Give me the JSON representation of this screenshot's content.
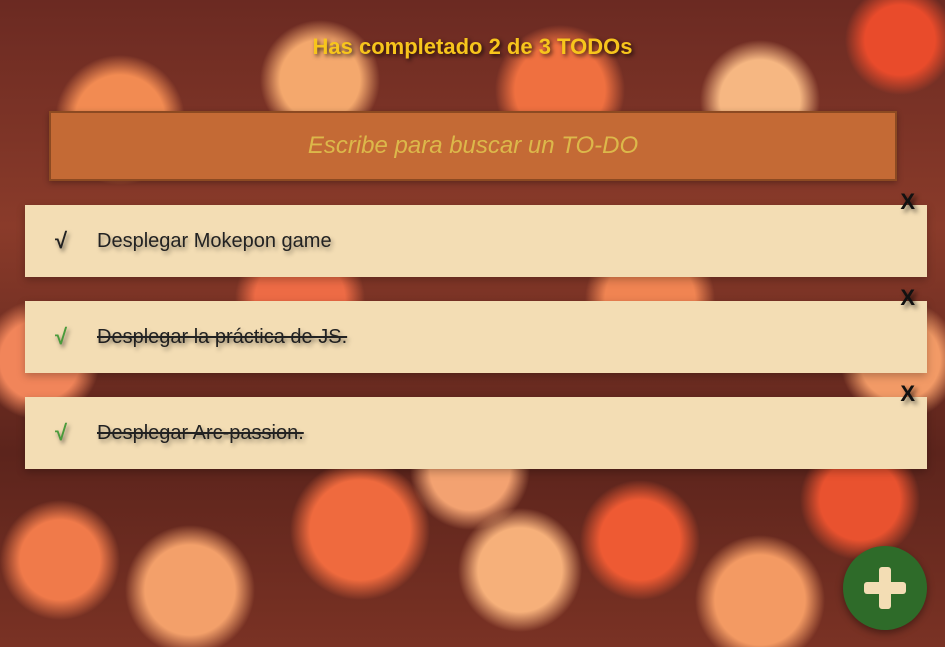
{
  "counter": {
    "text": "Has completado 2 de 3 TODOs"
  },
  "search": {
    "placeholder": "Escribe para buscar un TO-DO",
    "value": ""
  },
  "todos": [
    {
      "text": "Desplegar Mokepon game",
      "check": "√",
      "delete": "X",
      "completed": false
    },
    {
      "text": "Desplegar la práctica de JS.",
      "check": "√",
      "delete": "X",
      "completed": true
    },
    {
      "text": "Desplegar Arc-passion.",
      "check": "√",
      "delete": "X",
      "completed": true
    }
  ],
  "add_button": {
    "icon": "plus-icon"
  },
  "colors": {
    "counter": "#f7c51c",
    "search_bg": "#c46a35",
    "item_bg": "#f3ddb4",
    "check_done": "#4a9b3b",
    "add_bg": "#2e6b29"
  }
}
